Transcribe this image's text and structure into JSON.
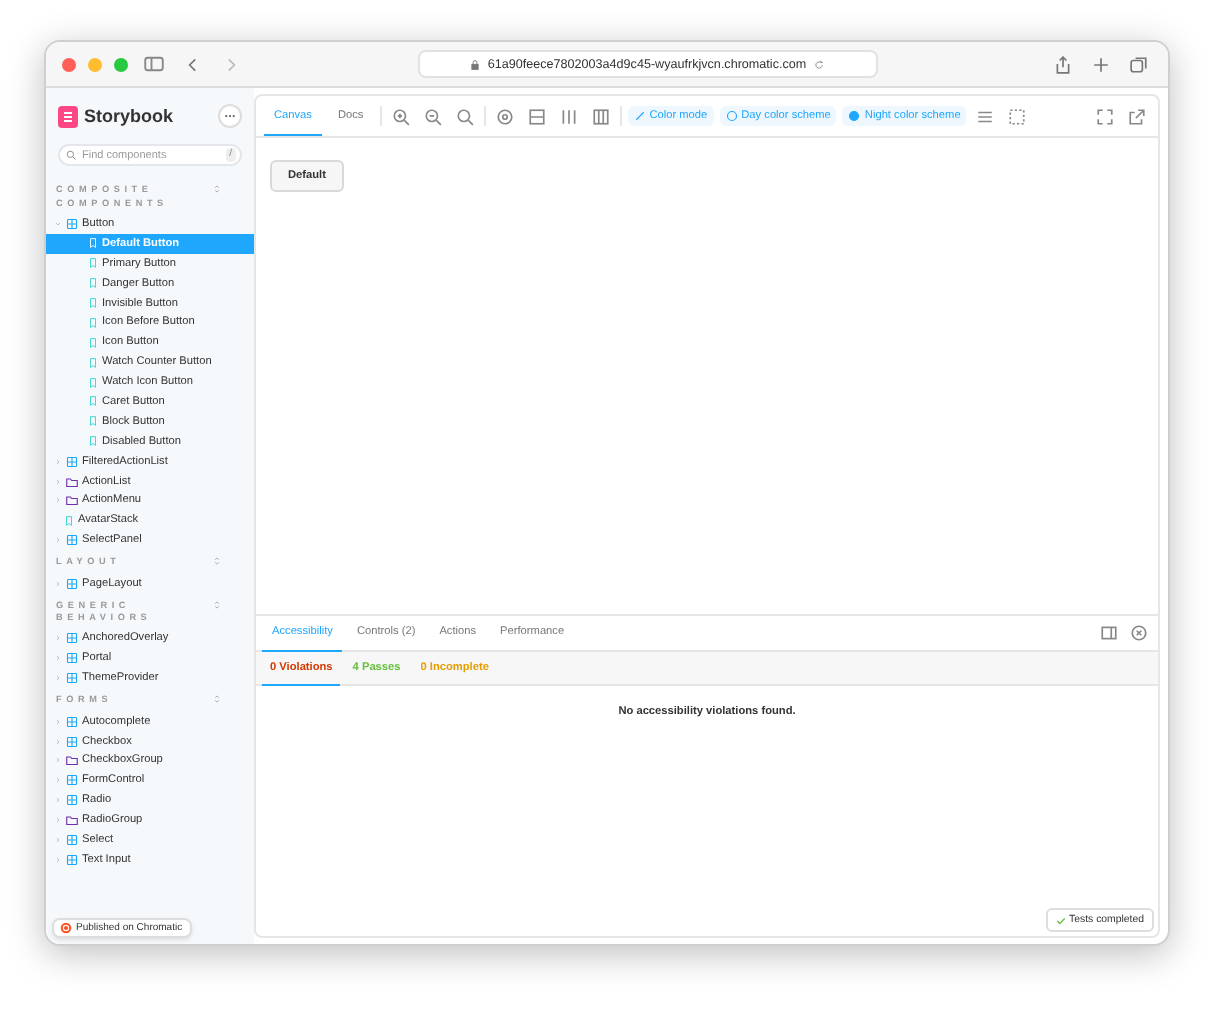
{
  "browser": {
    "url": "61a90feece7802003a4d9c45-wyaufrkjvcn.chromatic.com"
  },
  "sidebar": {
    "logo": "Storybook",
    "search": {
      "placeholder": "Find components",
      "shortcut": "/"
    },
    "sections": [
      {
        "title": "COMPOSITE COMPONENTS",
        "items": [
          {
            "label": "Button",
            "kind": "component",
            "selected": false,
            "expanded": true,
            "children": [
              {
                "label": "Default Button",
                "kind": "story",
                "selected": true
              },
              {
                "label": "Primary Button",
                "kind": "story",
                "selected": false
              },
              {
                "label": "Danger Button",
                "kind": "story",
                "selected": false
              },
              {
                "label": "Invisible Button",
                "kind": "story",
                "selected": false
              },
              {
                "label": "Icon Before Button",
                "kind": "story",
                "selected": false
              },
              {
                "label": "Icon Button",
                "kind": "story",
                "selected": false
              },
              {
                "label": "Watch Counter Button",
                "kind": "story",
                "selected": false
              },
              {
                "label": "Watch Icon Button",
                "kind": "story",
                "selected": false
              },
              {
                "label": "Caret Button",
                "kind": "story",
                "selected": false
              },
              {
                "label": "Block Button",
                "kind": "story",
                "selected": false
              },
              {
                "label": "Disabled Button",
                "kind": "story",
                "selected": false
              }
            ]
          },
          {
            "label": "FilteredActionList",
            "kind": "component",
            "selected": false,
            "expanded": false
          },
          {
            "label": "ActionList",
            "kind": "folder",
            "selected": false,
            "expanded": false
          },
          {
            "label": "ActionMenu",
            "kind": "folder",
            "selected": false,
            "expanded": false
          },
          {
            "label": "AvatarStack",
            "kind": "story",
            "selected": false
          },
          {
            "label": "SelectPanel",
            "kind": "component",
            "selected": false,
            "expanded": false
          }
        ]
      },
      {
        "title": "LAYOUT",
        "items": [
          {
            "label": "PageLayout",
            "kind": "component",
            "selected": false,
            "expanded": false
          }
        ]
      },
      {
        "title": "GENERIC BEHAVIORS",
        "items": [
          {
            "label": "AnchoredOverlay",
            "kind": "component",
            "selected": false,
            "expanded": false
          },
          {
            "label": "Portal",
            "kind": "component",
            "selected": false,
            "expanded": false
          },
          {
            "label": "ThemeProvider",
            "kind": "component",
            "selected": false,
            "expanded": false
          }
        ]
      },
      {
        "title": "FORMS",
        "items": [
          {
            "label": "Autocomplete",
            "kind": "component",
            "selected": false,
            "expanded": false
          },
          {
            "label": "Checkbox",
            "kind": "component",
            "selected": false,
            "expanded": false
          },
          {
            "label": "CheckboxGroup",
            "kind": "folder",
            "selected": false,
            "expanded": false
          },
          {
            "label": "FormControl",
            "kind": "component",
            "selected": false,
            "expanded": false
          },
          {
            "label": "Radio",
            "kind": "component",
            "selected": false,
            "expanded": false
          },
          {
            "label": "RadioGroup",
            "kind": "folder",
            "selected": false,
            "expanded": false
          },
          {
            "label": "Select",
            "kind": "component",
            "selected": false,
            "expanded": false
          },
          {
            "label": "Text Input",
            "kind": "component",
            "selected": false,
            "expanded": false
          }
        ]
      }
    ],
    "footer": "Published on Chromatic"
  },
  "toolbar": {
    "tabs": [
      {
        "label": "Canvas",
        "selected": true
      },
      {
        "label": "Docs",
        "selected": false
      }
    ],
    "pills": [
      {
        "label": "Color mode",
        "kind": "brush"
      },
      {
        "label": "Day color scheme",
        "kind": "ring"
      },
      {
        "label": "Night color scheme",
        "kind": "dot"
      }
    ]
  },
  "canvas": {
    "button": "Default"
  },
  "panel": {
    "tabs": [
      {
        "label": "Accessibility",
        "selected": true
      },
      {
        "label": "Controls (2)",
        "selected": false
      },
      {
        "label": "Actions",
        "selected": false
      },
      {
        "label": "Performance",
        "selected": false
      }
    ],
    "subtabs": [
      {
        "label": "0 Violations",
        "selected": true,
        "color": "#d43900"
      },
      {
        "label": "4 Passes",
        "selected": false,
        "color": "#66bf3c"
      },
      {
        "label": "0 Incomplete",
        "selected": false,
        "color": "#e69d00"
      }
    ],
    "message": "No accessibility violations found."
  },
  "status": "Tests completed"
}
